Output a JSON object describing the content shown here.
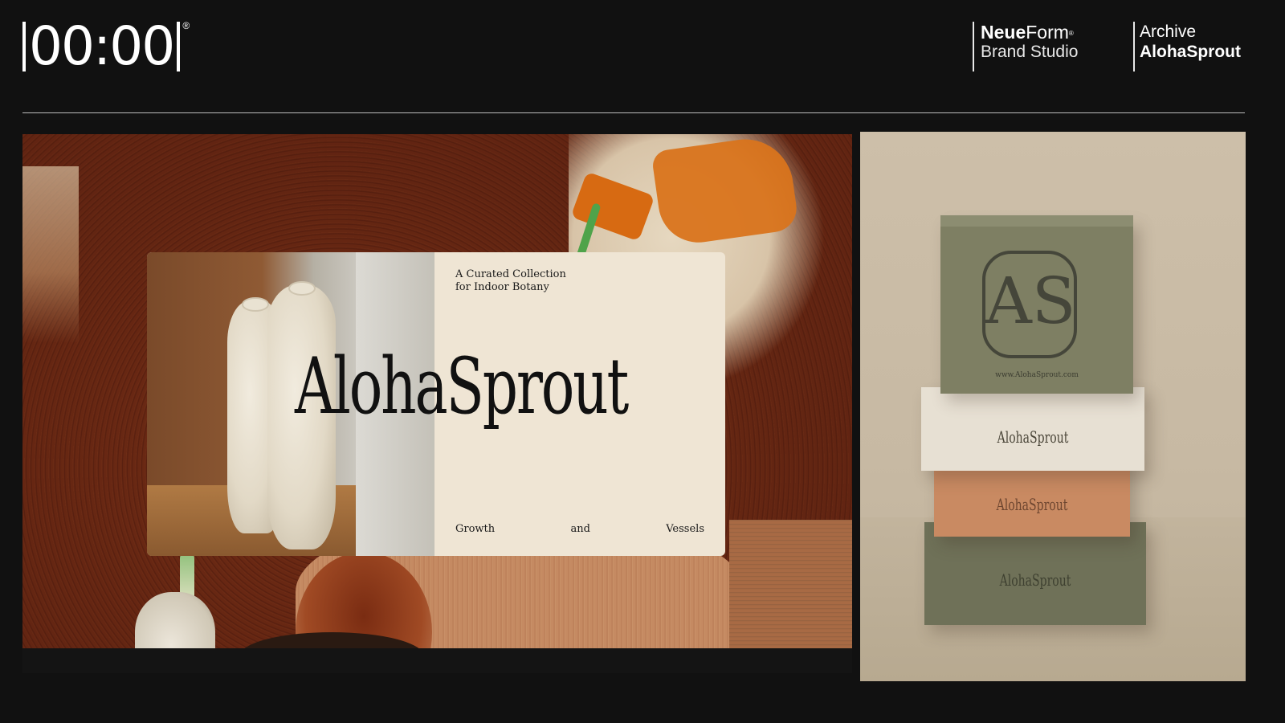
{
  "header": {
    "logo_text": "00:00",
    "logo_reg": "®",
    "studio": {
      "name_bold": "Neue",
      "name_light": "Form",
      "name_mark": "®",
      "subtitle": "Brand Studio"
    },
    "project": {
      "label": "Archive",
      "name": "AlohaSprout"
    }
  },
  "hero_card": {
    "tagline_line1": "A Curated Collection",
    "tagline_line2": "for Indoor Botany",
    "wordmark": "AlohaSprout",
    "footer": [
      "Growth",
      "and",
      "Vessels"
    ]
  },
  "packaging": {
    "emblem_letters": "AS",
    "url": "www.AlohaSprout.com",
    "box_mark": "AlohaSprout"
  },
  "colors": {
    "background": "#111111",
    "card": "#efe5d4",
    "box_green": "#7e7f63",
    "box_cream": "#e7e0d3",
    "box_orange": "#c98a62"
  }
}
